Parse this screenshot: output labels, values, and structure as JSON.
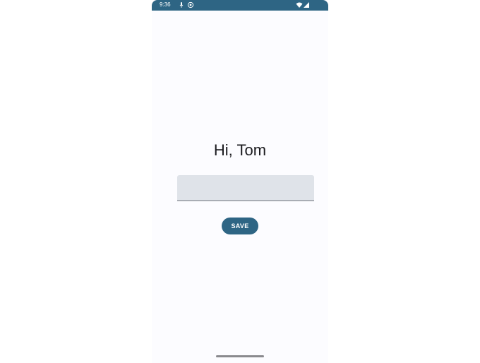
{
  "status_bar": {
    "time": "9:36",
    "left_icons": [
      "mic-icon",
      "app-notification-icon"
    ],
    "right_icons": [
      "wifi-icon",
      "battery-icon"
    ],
    "color": "#2e6584"
  },
  "main": {
    "greeting": "Hi, Tom",
    "text_field": {
      "value": "",
      "placeholder": ""
    },
    "save_label": "SAVE"
  },
  "colors": {
    "primary": "#2e6584",
    "background": "#fcfcff",
    "field_background": "#dfe3e9"
  }
}
